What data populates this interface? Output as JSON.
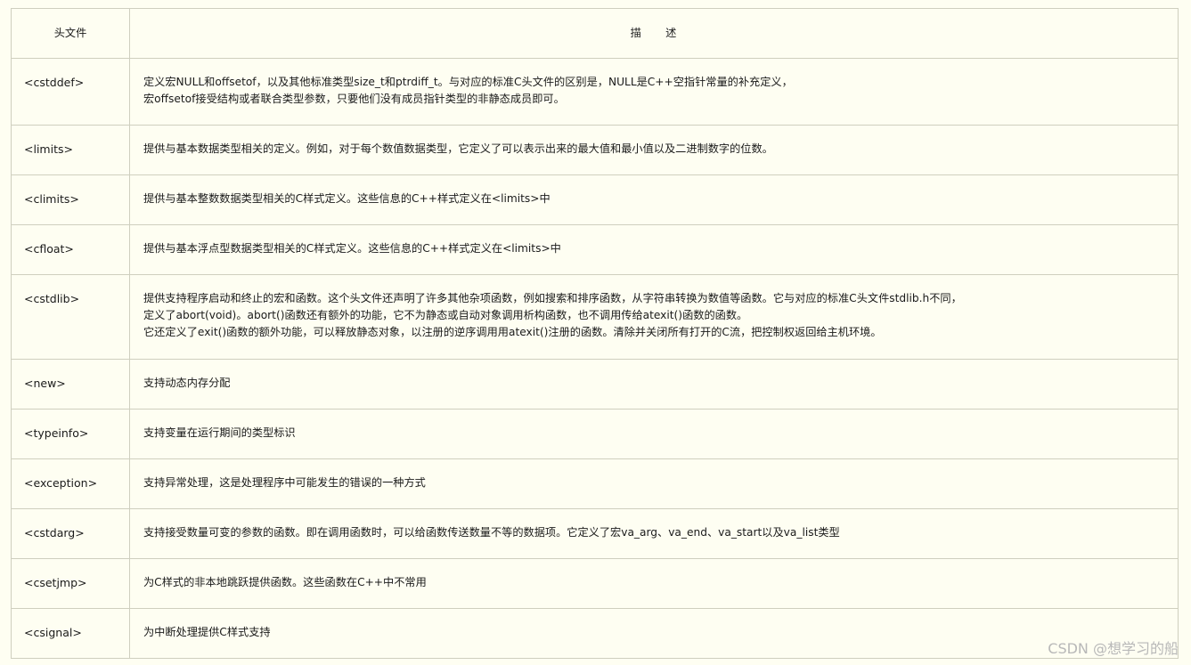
{
  "table": {
    "headers": {
      "header_file": "头文件",
      "description": "描　　述"
    },
    "rows": [
      {
        "header": "<cstddef>",
        "lines": [
          "定义宏NULL和offsetof，以及其他标准类型size_t和ptrdiff_t。与对应的标准C头文件的区别是，NULL是C++空指针常量的补充定义，",
          "宏offsetof接受结构或者联合类型参数，只要他们没有成员指针类型的非静态成员即可。"
        ]
      },
      {
        "header": "<limits>",
        "lines": [
          "提供与基本数据类型相关的定义。例如，对于每个数值数据类型，它定义了可以表示出来的最大值和最小值以及二进制数字的位数。"
        ]
      },
      {
        "header": "<climits>",
        "lines": [
          "提供与基本整数数据类型相关的C样式定义。这些信息的C++样式定义在<limits>中"
        ]
      },
      {
        "header": "<cfloat>",
        "lines": [
          "提供与基本浮点型数据类型相关的C样式定义。这些信息的C++样式定义在<limits>中"
        ]
      },
      {
        "header": "<cstdlib>",
        "lines": [
          "提供支持程序启动和终止的宏和函数。这个头文件还声明了许多其他杂项函数，例如搜索和排序函数，从字符串转换为数值等函数。它与对应的标准C头文件stdlib.h不同，",
          "定义了abort(void)。abort()函数还有额外的功能，它不为静态或自动对象调用析构函数，也不调用传给atexit()函数的函数。",
          "它还定义了exit()函数的额外功能，可以释放静态对象，以注册的逆序调用用atexit()注册的函数。清除并关闭所有打开的C流，把控制权返回给主机环境。"
        ]
      },
      {
        "header": "<new>",
        "lines": [
          "支持动态内存分配"
        ]
      },
      {
        "header": "<typeinfo>",
        "lines": [
          "支持变量在运行期间的类型标识"
        ]
      },
      {
        "header": "<exception>",
        "lines": [
          "支持异常处理，这是处理程序中可能发生的错误的一种方式"
        ]
      },
      {
        "header": "<cstdarg>",
        "lines": [
          "支持接受数量可变的参数的函数。即在调用函数时，可以给函数传送数量不等的数据项。它定义了宏va_arg、va_end、va_start以及va_list类型"
        ]
      },
      {
        "header": "<csetjmp>",
        "lines": [
          "为C样式的非本地跳跃提供函数。这些函数在C++中不常用"
        ]
      },
      {
        "header": "<csignal>",
        "lines": [
          "为中断处理提供C样式支持"
        ]
      }
    ]
  },
  "watermark": "CSDN @想学习的船"
}
